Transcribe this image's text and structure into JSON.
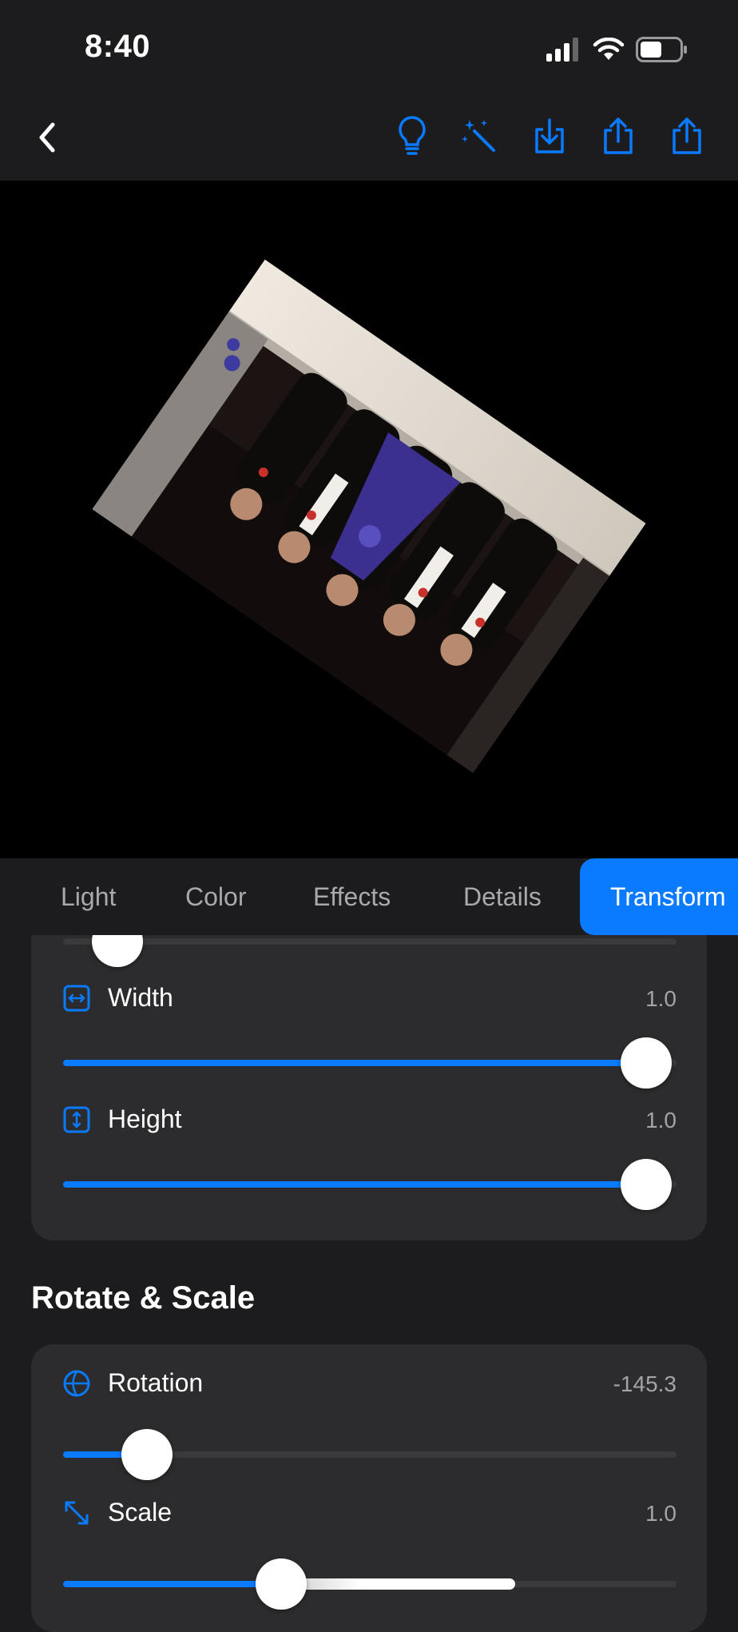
{
  "status_bar": {
    "time": "8:40",
    "signal_icon": "cell-signal-icon",
    "wifi_icon": "wifi-icon",
    "battery_icon": "battery-icon"
  },
  "nav": {
    "back_icon": "chevron-left-icon",
    "tools": [
      "lightbulb-icon",
      "magic-wand-icon",
      "download-icon",
      "share-icon",
      "share-icon"
    ],
    "accent": "#0a7aff"
  },
  "tabs": [
    {
      "label": "Light",
      "active": false
    },
    {
      "label": "Color",
      "active": false
    },
    {
      "label": "Effects",
      "active": false
    },
    {
      "label": "Details",
      "active": false
    },
    {
      "label": "Transform",
      "active": true
    }
  ],
  "perspective_panel": {
    "rows": [
      {
        "label": "Width",
        "value": "1.0",
        "icon": "width-icon",
        "level": 1.0
      },
      {
        "label": "Height",
        "value": "1.0",
        "icon": "height-icon",
        "level": 1.0
      }
    ]
  },
  "rotate_scale": {
    "title": "Rotate & Scale",
    "rows": [
      {
        "label": "Rotation",
        "value": "-145.3",
        "icon": "rotation-icon",
        "level": 0.1
      },
      {
        "label": "Scale",
        "value": "1.0",
        "icon": "scale-icon",
        "level": 0.33
      }
    ]
  },
  "photo": {
    "rotation_deg": -145.3
  }
}
